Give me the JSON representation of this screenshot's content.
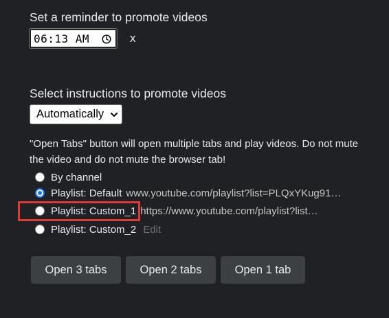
{
  "reminder": {
    "heading": "Set a reminder to promote videos",
    "time_value": "06:13 AM",
    "clear_label": "x"
  },
  "instructions": {
    "heading": "Select instructions to promote videos",
    "selected_option": "Automatically",
    "info_text": "\"Open Tabs\" button will open multiple tabs and play videos. Do not mute the video and do not mute the browser tab!"
  },
  "options": [
    {
      "label": "By channel",
      "url": "",
      "checked": false
    },
    {
      "label": "Playlist: Default",
      "url": "www.youtube.com/playlist?list=PLQxYKug91…",
      "checked": true
    },
    {
      "label": "Playlist: Custom_1",
      "url": "https://www.youtube.com/playlist?list…",
      "checked": false,
      "highlighted": true
    },
    {
      "label": "Playlist: Custom_2",
      "edit_label": "Edit",
      "checked": false
    }
  ],
  "buttons": {
    "open3": "Open 3 tabs",
    "open2": "Open 2 tabs",
    "open1": "Open 1 tab"
  },
  "icons": {
    "time_picker": "clock-icon",
    "dropdown": "chevron-down-icon"
  },
  "colors": {
    "background": "#202124",
    "button": "#3c4043",
    "radio_checked": "#1a73e8",
    "highlight_box": "#e53935"
  }
}
